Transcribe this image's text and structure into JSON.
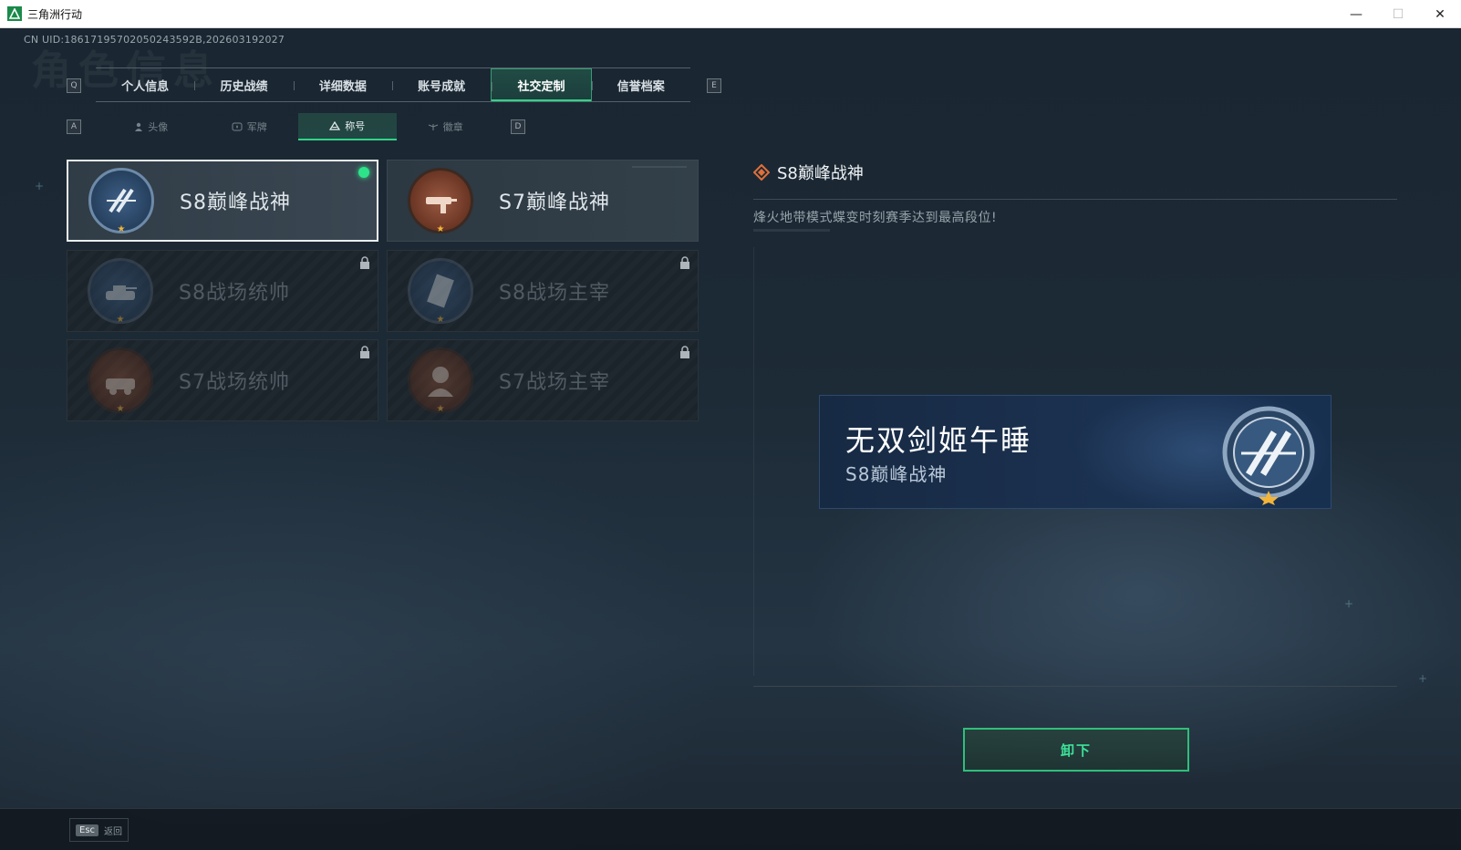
{
  "window": {
    "title": "三角洲行动",
    "minimize": "—",
    "maximize": "☐",
    "close": "✕"
  },
  "header": {
    "uid": "CN UID:18617195702050243592B,202603192027",
    "watermark": "角色信息"
  },
  "main_tabs": {
    "prev_key": "Q",
    "next_key": "E",
    "items": [
      {
        "label": "个人信息"
      },
      {
        "label": "历史战绩"
      },
      {
        "label": "详细数据"
      },
      {
        "label": "账号成就"
      },
      {
        "label": "社交定制",
        "active": true
      },
      {
        "label": "信誉档案"
      }
    ]
  },
  "sub_tabs": {
    "prev_key": "A",
    "next_key": "D",
    "items": [
      {
        "label": "头像"
      },
      {
        "label": "军牌"
      },
      {
        "label": "称号",
        "active": true
      },
      {
        "label": "徽章"
      }
    ]
  },
  "titles": [
    {
      "name": "S8巅峰战神",
      "state": "selected",
      "equipped": true,
      "badge": "s8-peak-emblem",
      "badge_color": "#2d4a6b"
    },
    {
      "name": "S7巅峰战神",
      "state": "unlocked",
      "badge": "s7-peak-emblem",
      "badge_color": "#7a4030"
    },
    {
      "name": "S8战场统帅",
      "state": "locked",
      "badge": "s8-tank-emblem",
      "badge_color": "#2d4a6b"
    },
    {
      "name": "S8战场主宰",
      "state": "locked",
      "badge": "s8-building-emblem",
      "badge_color": "#2d4a6b"
    },
    {
      "name": "S7战场统帅",
      "state": "locked",
      "badge": "s7-vehicle-emblem",
      "badge_color": "#6a3a28"
    },
    {
      "name": "S7战场主宰",
      "state": "locked",
      "badge": "s7-soldier-emblem",
      "badge_color": "#6a3a28"
    }
  ],
  "detail": {
    "title": "S8巅峰战神",
    "description": "烽火地带模式蝶变时刻赛季达到最高段位!"
  },
  "nameplate": {
    "player_name": "无双剑姬午睡",
    "title": "S8巅峰战神"
  },
  "actions": {
    "unequip_label": "卸下"
  },
  "footer": {
    "esc_key": "Esc",
    "back_label": "返回"
  },
  "colors": {
    "accent_green": "#30d488",
    "star_gold": "#f2b53a",
    "detail_icon_orange": "#e0703a"
  }
}
